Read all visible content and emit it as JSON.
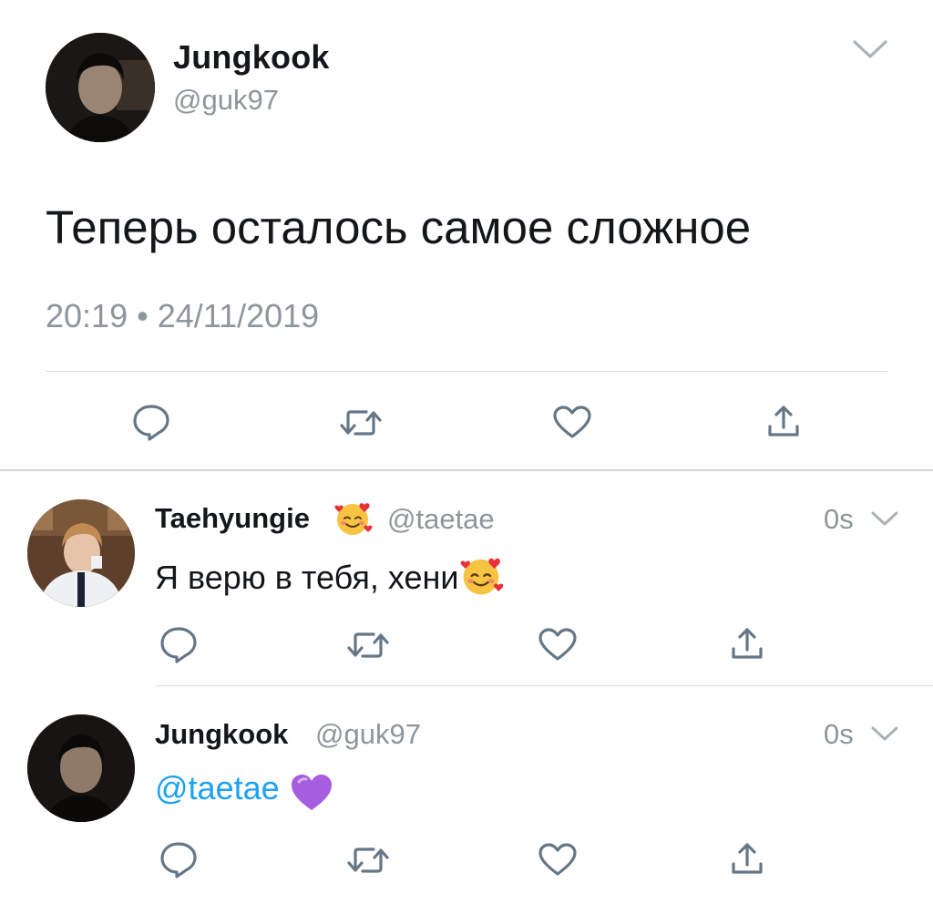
{
  "main_tweet": {
    "author_name": "Jungkook",
    "author_handle": "@guk97",
    "text": "Теперь осталось самое сложное",
    "timestamp": "20:19 • 24/11/2019",
    "actions": [
      "reply-icon",
      "retweet-icon",
      "like-icon",
      "share-icon"
    ]
  },
  "replies": [
    {
      "author_name": "Taehyungie",
      "name_emoji": "smiling-face-with-hearts-icon",
      "author_handle": "@taetae",
      "time": "0s",
      "text": "Я верю в тебя, хени",
      "text_emoji": "smiling-face-with-hearts-icon"
    },
    {
      "author_name": "Jungkook",
      "author_handle": "@guk97",
      "time": "0s",
      "mention": "@taetae",
      "text_emoji": "purple-heart-icon"
    }
  ],
  "colors": {
    "text": "#14171a",
    "secondary": "#8e959c",
    "link": "#1da1f2",
    "icon": "#657786"
  }
}
